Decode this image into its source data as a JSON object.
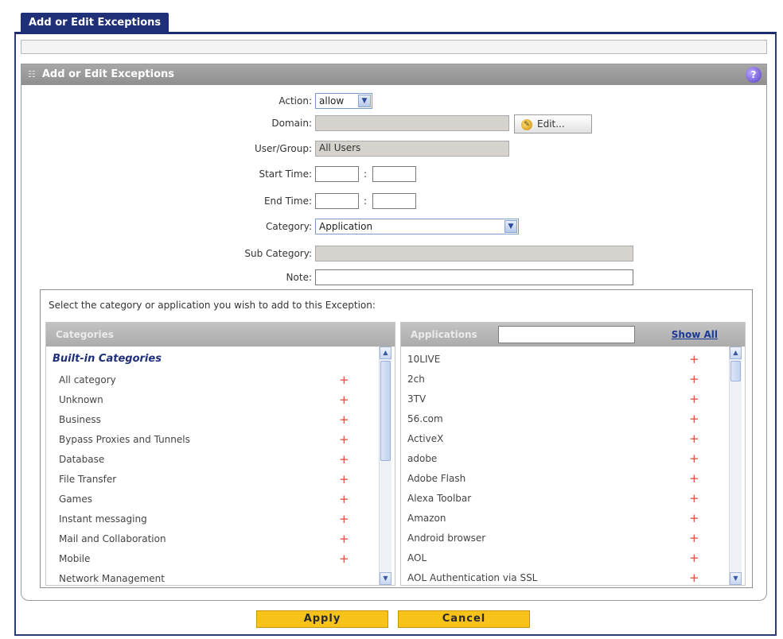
{
  "window": {
    "tab_title": "Add or Edit Exceptions",
    "panel_title": "Add or Edit Exceptions",
    "help_icon": "?"
  },
  "form": {
    "action": {
      "label": "Action:",
      "value": "allow"
    },
    "domain": {
      "label": "Domain:",
      "value": "",
      "edit_label": "Edit..."
    },
    "user_group": {
      "label": "User/Group:",
      "value": "All Users"
    },
    "start_time": {
      "label": "Start Time:",
      "hour": "",
      "minute": "",
      "sep": ":"
    },
    "end_time": {
      "label": "End Time:",
      "hour": "",
      "minute": "",
      "sep": ":"
    },
    "category": {
      "label": "Category:",
      "value": "Application"
    },
    "sub_category": {
      "label": "Sub Category:",
      "value": ""
    },
    "note": {
      "label": "Note:",
      "value": ""
    }
  },
  "selection": {
    "prompt": "Select the category or application you wish to add to this Exception:",
    "categories": {
      "header": "Categories",
      "group": "Built-in Categories",
      "items": [
        "All category",
        "Unknown",
        "Business",
        "Bypass Proxies and Tunnels",
        "Database",
        "File Transfer",
        "Games",
        "Instant messaging",
        "Mail and Collaboration",
        "Mobile",
        "Network Management"
      ]
    },
    "applications": {
      "header": "Applications",
      "search_value": "",
      "show_all": "Show All",
      "items": [
        "10LIVE",
        "2ch",
        "3TV",
        "56.com",
        "ActiveX",
        "adobe",
        "Adobe Flash",
        "Alexa Toolbar",
        "Amazon",
        "Android browser",
        "AOL",
        "AOL Authentication via SSL"
      ]
    }
  },
  "buttons": {
    "apply": "Apply",
    "cancel": "Cancel"
  },
  "colors": {
    "tab": "#1f2f78",
    "header": "#9b9b9b",
    "button": "#f7c21a",
    "plus": "#e04a3a",
    "link": "#1a3a9a"
  }
}
